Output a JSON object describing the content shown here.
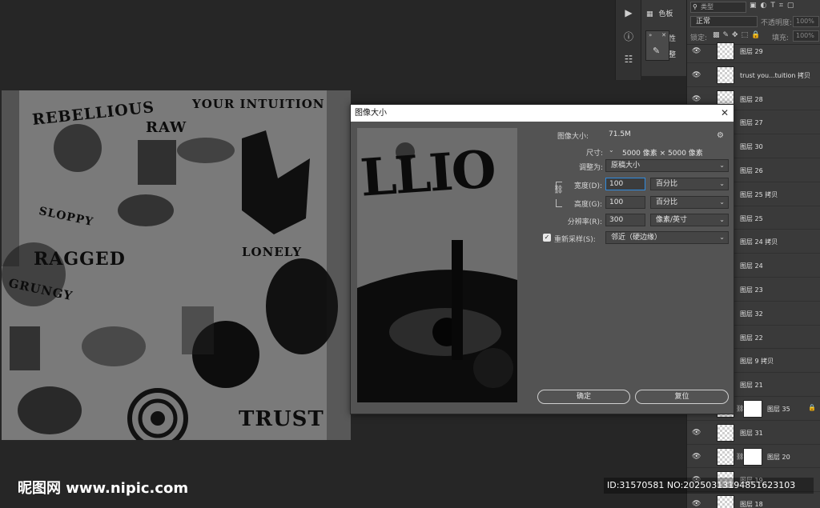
{
  "toolstrip": {
    "icons": [
      "play-icon",
      "info-icon",
      "adjust-icon"
    ],
    "swatches_label": "色板",
    "properties_label": "性",
    "extra_label": "整"
  },
  "layers_panel": {
    "search_placeholder": "类型",
    "blend_mode": "正常",
    "opacity_label": "不透明度:",
    "opacity_value": "100%",
    "lock_label": "锁定:",
    "fill_label": "填充:",
    "fill_value": "100%",
    "layers": [
      {
        "name": "图层 29",
        "mask": false,
        "lock": false
      },
      {
        "name": "trust you...tuition 拷贝",
        "mask": false,
        "lock": false
      },
      {
        "name": "图层 28",
        "mask": false,
        "lock": false
      },
      {
        "name": "图层 27",
        "mask": false,
        "lock": false
      },
      {
        "name": "图层 30",
        "mask": false,
        "lock": false
      },
      {
        "name": "图层 26",
        "mask": false,
        "lock": false
      },
      {
        "name": "图层 25 拷贝",
        "mask": false,
        "lock": false
      },
      {
        "name": "图层 25",
        "mask": false,
        "lock": false
      },
      {
        "name": "图层 24 拷贝",
        "mask": false,
        "lock": false
      },
      {
        "name": "图层 24",
        "mask": false,
        "lock": false
      },
      {
        "name": "图层 23",
        "mask": false,
        "lock": false
      },
      {
        "name": "图层 32",
        "mask": false,
        "lock": false
      },
      {
        "name": "图层 22",
        "mask": false,
        "lock": false
      },
      {
        "name": "图层 9 拷贝",
        "mask": false,
        "lock": false
      },
      {
        "name": "图层 21",
        "mask": false,
        "lock": false
      },
      {
        "name": "图层 35",
        "mask": true,
        "lock": true
      },
      {
        "name": "图层 31",
        "mask": false,
        "lock": false
      },
      {
        "name": "图层 20",
        "mask": true,
        "lock": false
      },
      {
        "name": "图层 19",
        "mask": false,
        "lock": false
      },
      {
        "name": "图层 18",
        "mask": false,
        "lock": false
      }
    ]
  },
  "artwork": {
    "words": [
      "REBELLIOUS",
      "YOUR INTUITION",
      "RAW",
      "SLOPPY",
      "RAGGED",
      "GRUNGY",
      "LONELY",
      "TRUST"
    ]
  },
  "dialog": {
    "title": "图像大小",
    "image_size_label": "图像大小:",
    "image_size_value": "71.5M",
    "dimensions_label": "尺寸:",
    "dimensions_value": "5000 像素 × 5000 像素",
    "fit_to_label": "调整为:",
    "fit_to_value": "原稿大小",
    "width_label": "宽度(D):",
    "width_value": "100",
    "width_unit": "百分比",
    "height_label": "高度(G):",
    "height_value": "100",
    "height_unit": "百分比",
    "resolution_label": "分辨率(R):",
    "resolution_value": "300",
    "resolution_unit": "像素/英寸",
    "resample_label": "重新采样(S):",
    "resample_checked": true,
    "resample_value": "邻近（硬边缘）",
    "ok_label": "确定",
    "reset_label": "复位",
    "preview_text": "LLIO"
  },
  "watermark": {
    "left": "昵图网 www.nipic.com",
    "right": "ID:31570581 NO:20250313194851623103"
  }
}
